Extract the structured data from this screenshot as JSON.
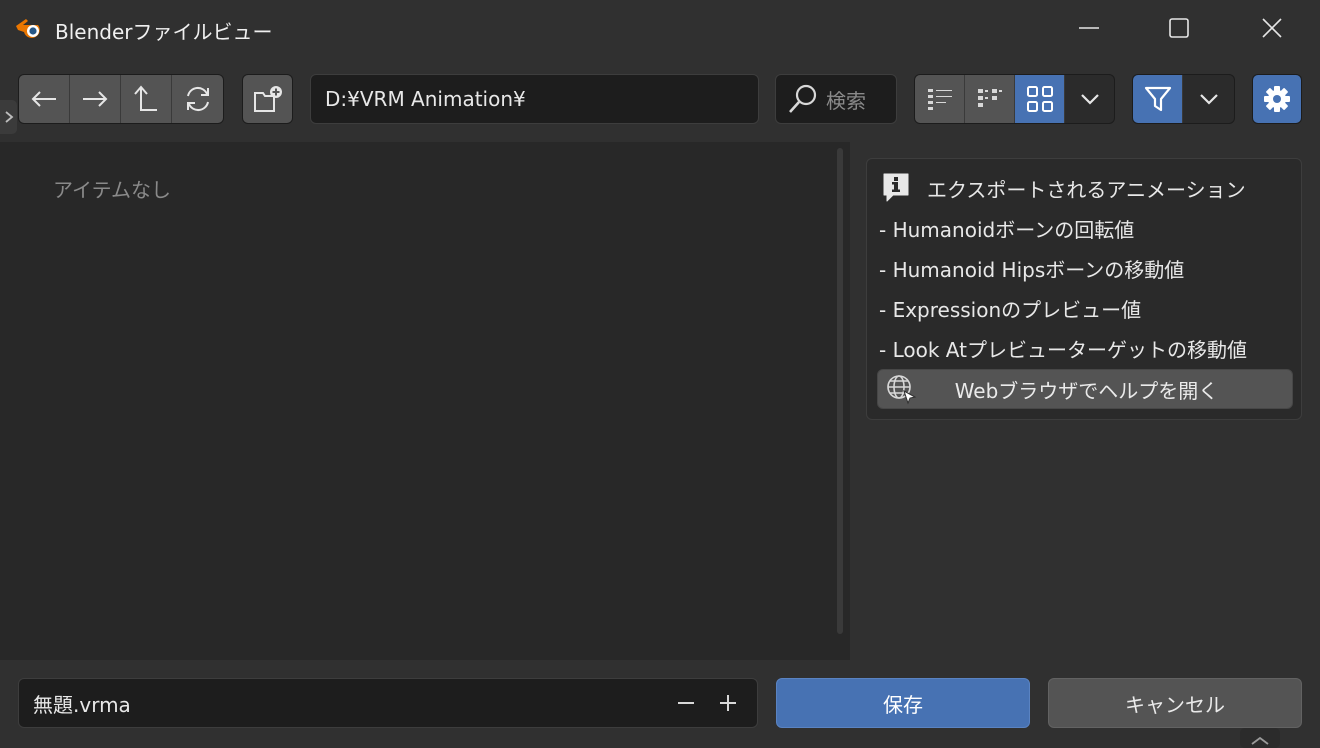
{
  "window": {
    "title": "Blenderファイルビュー"
  },
  "toolbar": {
    "path": "D:¥VRM Animation¥",
    "search_placeholder": "検索"
  },
  "file_list": {
    "empty_text": "アイテムなし"
  },
  "panel": {
    "title": "エクスポートされるアニメーション",
    "lines": [
      "- Humanoidボーンの回転値",
      "- Humanoid Hipsボーンの移動値",
      "- Expressionのプレビュー値",
      "- Look Atプレビューターゲットの移動値"
    ],
    "help_button": "Webブラウザでヘルプを開く"
  },
  "footer": {
    "filename": "無題.vrma",
    "save_label": "保存",
    "cancel_label": "キャンセル"
  },
  "colors": {
    "accent": "#4772b3",
    "background": "#303030"
  }
}
